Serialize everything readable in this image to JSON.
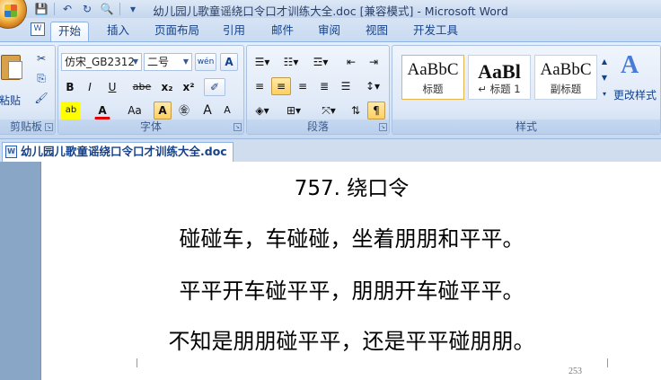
{
  "window": {
    "title": "幼儿园儿歌童谣绕口令口才训练大全.doc [兼容模式] - Microsoft Word"
  },
  "quick_access": {
    "save": "💾",
    "undo": "↶",
    "redo": "↻",
    "print_preview": "🔍",
    "customize": "▾"
  },
  "tabs": [
    {
      "label": "开始"
    },
    {
      "label": "插入"
    },
    {
      "label": "页面布局"
    },
    {
      "label": "引用"
    },
    {
      "label": "邮件"
    },
    {
      "label": "审阅"
    },
    {
      "label": "视图"
    },
    {
      "label": "开发工具"
    }
  ],
  "clipboard": {
    "label": "剪贴板",
    "paste": "粘贴"
  },
  "font": {
    "label": "字体",
    "name": "仿宋_GB2312",
    "size": "二号",
    "wen_btn": "wén",
    "char_border": "A",
    "bold": "B",
    "italic": "I",
    "underline": "U",
    "strike": "abe",
    "subscript": "x₂",
    "superscript": "x²",
    "clear": "Aa",
    "grow": "A",
    "shrink": "A"
  },
  "paragraph": {
    "label": "段落"
  },
  "styles": {
    "label": "样式",
    "items": [
      {
        "sample": "AaBbC",
        "name": "标题"
      },
      {
        "sample": "AaBl",
        "name": "↵ 标题 1"
      },
      {
        "sample": "AaBbC",
        "name": "副标题"
      }
    ],
    "change": "更改样式"
  },
  "document": {
    "tab_name": "幼儿园儿歌童谣绕口令口才训练大全.doc",
    "heading": "757.   绕口令",
    "lines": [
      "碰碰车，车碰碰，坐着朋朋和平平。",
      "平平开车碰平平，朋朋开车碰平平。",
      "不知是朋朋碰平平，还是平平碰朋朋。"
    ],
    "page_number": "253"
  }
}
